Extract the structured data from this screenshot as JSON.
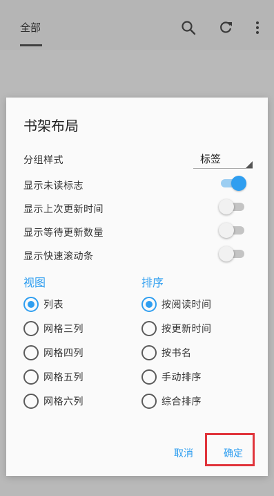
{
  "app_bar": {
    "tab_label": "全部",
    "icons": [
      "search-icon",
      "refresh-icon",
      "more-vert-icon"
    ]
  },
  "dialog": {
    "title": "书架布局",
    "group_style": {
      "label": "分组样式",
      "value": "标签"
    },
    "toggles": [
      {
        "label": "显示未读标志",
        "on": true
      },
      {
        "label": "显示上次更新时间",
        "on": false
      },
      {
        "label": "显示等待更新数量",
        "on": false
      },
      {
        "label": "显示快速滚动条",
        "on": false
      }
    ],
    "view": {
      "heading": "视图",
      "options": [
        "列表",
        "网格三列",
        "网格四列",
        "网格五列",
        "网格六列"
      ],
      "selected": 0
    },
    "sort": {
      "heading": "排序",
      "options": [
        "按阅读时间",
        "按更新时间",
        "按书名",
        "手动排序",
        "综合排序"
      ],
      "selected": 0
    },
    "buttons": {
      "cancel": "取消",
      "confirm": "确定"
    }
  },
  "colors": {
    "accent": "#2f9ef0",
    "highlight": "#e0343b"
  }
}
